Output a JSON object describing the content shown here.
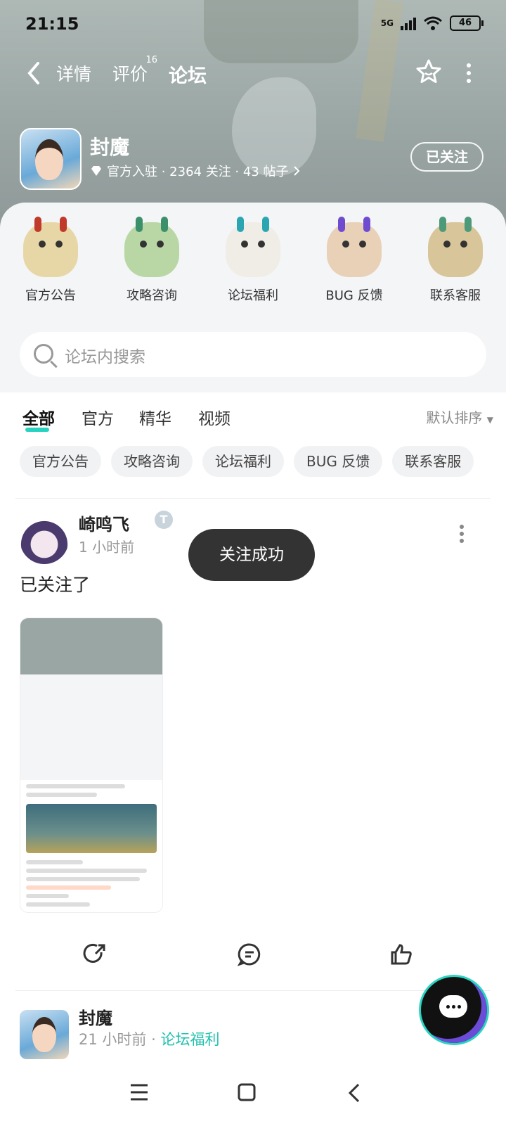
{
  "status": {
    "time": "21:15",
    "network": "5G",
    "battery": "46"
  },
  "nav": {
    "back_label": "‹",
    "tabs": [
      {
        "label": "详情"
      },
      {
        "label": "评价",
        "badge": "16"
      },
      {
        "label": "论坛",
        "active": true
      }
    ]
  },
  "game": {
    "name": "封魔",
    "meta": "官方入驻 · 2364 关注 · 43 帖子",
    "follow_label": "已关注"
  },
  "categories": [
    {
      "label": "官方公告"
    },
    {
      "label": "攻略咨询"
    },
    {
      "label": "论坛福利"
    },
    {
      "label": "BUG 反馈"
    },
    {
      "label": "联系客服"
    }
  ],
  "search": {
    "placeholder": "论坛内搜索"
  },
  "filter_tabs": [
    {
      "label": "全部",
      "active": true
    },
    {
      "label": "官方"
    },
    {
      "label": "精华"
    },
    {
      "label": "视频"
    }
  ],
  "sort_label": "默认排序",
  "chips": [
    {
      "label": "官方公告"
    },
    {
      "label": "攻略咨询"
    },
    {
      "label": "论坛福利"
    },
    {
      "label": "BUG 反馈"
    },
    {
      "label": "联系客服"
    }
  ],
  "post": {
    "user": "崎鸣飞",
    "level": "T",
    "time": "1 小时前",
    "text": "已关注了"
  },
  "toast": "关注成功",
  "post2": {
    "user": "封魔",
    "time": "21 小时前",
    "tag": "论坛福利"
  },
  "colors": {
    "accent": "#27d3c0",
    "tag": "#1fbfae"
  }
}
